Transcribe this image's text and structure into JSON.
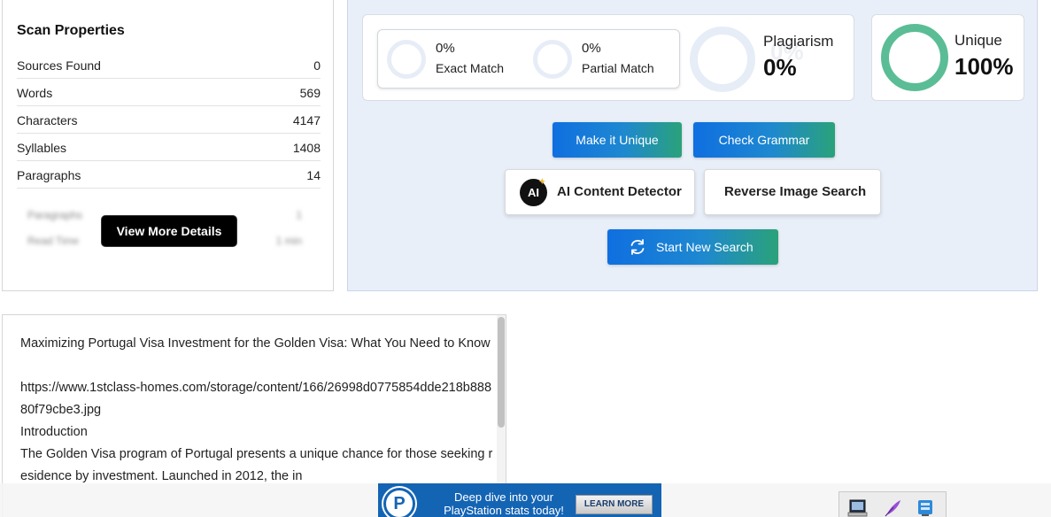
{
  "scan_properties": {
    "title": "Scan Properties",
    "rows": [
      {
        "label": "Sources Found",
        "value": "0"
      },
      {
        "label": "Words",
        "value": "569"
      },
      {
        "label": "Characters",
        "value": "4147"
      },
      {
        "label": "Syllables",
        "value": "1408"
      },
      {
        "label": "Paragraphs",
        "value": "14"
      }
    ],
    "blurred_rows": [
      {
        "label": "Paragraphs",
        "value": "1"
      },
      {
        "label": "Read Time",
        "value": "1 min"
      }
    ],
    "view_more_label": "View More Details"
  },
  "results": {
    "exact_match": {
      "value": "0%",
      "label": "Exact Match"
    },
    "partial_match": {
      "value": "0%",
      "label": "Partial Match"
    },
    "plagiarism": {
      "label": "Plagiarism",
      "value": "0%"
    },
    "unique": {
      "label": "Unique",
      "value": "100%",
      "fraction": 1.0
    }
  },
  "actions": {
    "make_unique": "Make it Unique",
    "check_grammar": "Check Grammar",
    "ai_detector": "AI Content Detector",
    "ai_icon_text": "AI",
    "reverse_image": "Reverse Image Search",
    "start_new": "Start New Search"
  },
  "document": {
    "paragraphs": [
      "Maximizing Portugal Visa Investment for the Golden Visa: What You Need to Know",
      "",
      "https://www.1stclass-homes.com/storage/content/166/26998d0775854dde218b88880f79cbe3.jpg",
      "Introduction",
      "The Golden Visa program of Portugal presents a unique chance for those seeking residence by investment. Launched in 2012, the in"
    ]
  },
  "ad": {
    "logo_letter": "P",
    "text": "Deep dive into your PlayStation stats today!",
    "button": "LEARN MORE"
  },
  "colors": {
    "accent_blue": "#0f6fe0",
    "accent_green": "#2aa27a",
    "unique_ring": "#5bbd95",
    "panel_bg": "#e9eff9"
  }
}
